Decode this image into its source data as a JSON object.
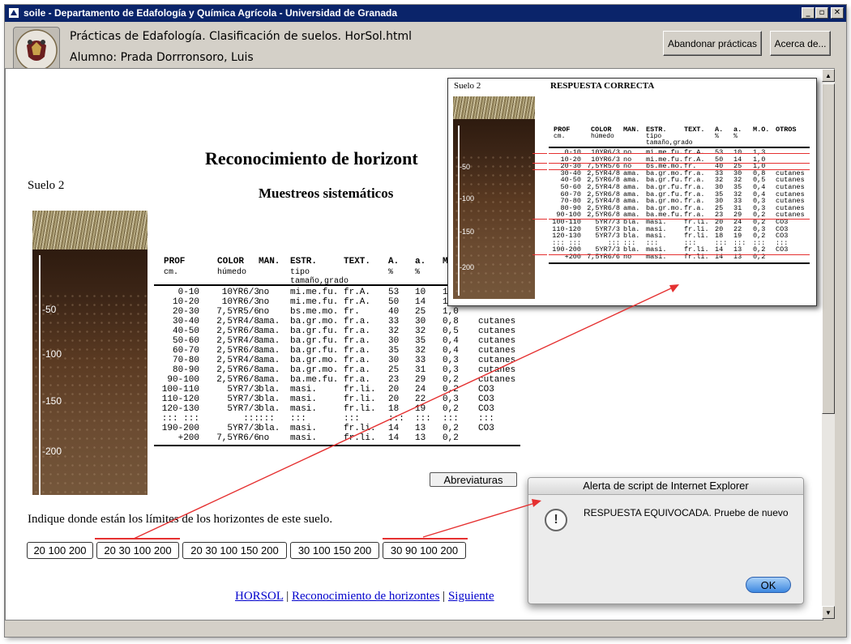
{
  "window": {
    "title": "soile - Departamento de Edafología y Química Agrícola - Universidad de Granada",
    "controls": {
      "minimize": "_",
      "maximize": "▫",
      "close": "✕"
    }
  },
  "header": {
    "practice_title": "Prácticas de Edafología. Clasificación de suelos. HorSol.html",
    "student": "Alumno: Prada Dorrronsoro, Luis",
    "abandon_button": "Abandonar prácticas",
    "about_button": "Acerca de..."
  },
  "page": {
    "title": "Reconocimiento de horizont",
    "subtitle": "Muestreos sistemáticos",
    "soil_label": "Suelo 2",
    "question": "Indique donde están los límites de los horizontes de este suelo.",
    "abbreviations_button": "Abreviaturas",
    "depth_marks": [
      "-50",
      "-100",
      "-150",
      "-200"
    ]
  },
  "table": {
    "headers": [
      "PROF",
      "COLOR",
      "MAN.",
      "ESTR.",
      "TEXT.",
      "A.",
      "a.",
      "M.O.",
      "OTROS"
    ],
    "subheaders": [
      "cm.",
      "húmedo",
      "",
      "tipo\ntamaño,grado",
      "",
      "%",
      "%",
      "",
      ""
    ],
    "main_visible_headers": [
      "PROF",
      "COLOR",
      "MAN.",
      "ESTR.",
      "TEXT.",
      "A.",
      "a."
    ],
    "rows": [
      [
        "0-10",
        "10YR6/3",
        "no",
        "mi.me.fu.",
        "fr.A.",
        "53",
        "10",
        "1,3",
        ""
      ],
      [
        "10-20",
        "10YR6/3",
        "no",
        "mi.me.fu.",
        "fr.A.",
        "50",
        "14",
        "1,0",
        ""
      ],
      [
        "20-30",
        "7,5YR5/6",
        "no",
        "bs.me.mo.",
        "fr.",
        "40",
        "25",
        "1,0",
        ""
      ],
      [
        "30-40",
        "2,5YR4/8",
        "ama.",
        "ba.gr.mo.",
        "fr.a.",
        "33",
        "30",
        "0,8",
        "cutanes"
      ],
      [
        "40-50",
        "2,5YR6/8",
        "ama.",
        "ba.gr.fu.",
        "fr.a.",
        "32",
        "32",
        "0,5",
        "cutanes"
      ],
      [
        "50-60",
        "2,5YR4/8",
        "ama.",
        "ba.gr.fu.",
        "fr.a.",
        "30",
        "35",
        "0,4",
        "cutanes"
      ],
      [
        "60-70",
        "2,5YR6/8",
        "ama.",
        "ba.gr.fu.",
        "fr.a.",
        "35",
        "32",
        "0,4",
        "cutanes"
      ],
      [
        "70-80",
        "2,5YR4/8",
        "ama.",
        "ba.gr.mo.",
        "fr.a.",
        "30",
        "33",
        "0,3",
        "cutanes"
      ],
      [
        "80-90",
        "2,5YR6/8",
        "ama.",
        "ba.gr.mo.",
        "fr.a.",
        "25",
        "31",
        "0,3",
        "cutanes"
      ],
      [
        "90-100",
        "2,5YR6/8",
        "ama.",
        "ba.me.fu.",
        "fr.a.",
        "23",
        "29",
        "0,2",
        "cutanes"
      ],
      [
        "100-110",
        "5YR7/3",
        "bla.",
        "masi.",
        "fr.li.",
        "20",
        "24",
        "0,2",
        "CO3"
      ],
      [
        "110-120",
        "5YR7/3",
        "bla.",
        "masi.",
        "fr.li.",
        "20",
        "22",
        "0,3",
        "CO3"
      ],
      [
        "120-130",
        "5YR7/3",
        "bla.",
        "masi.",
        "fr.li.",
        "18",
        "19",
        "0,2",
        "CO3"
      ],
      [
        "::: :::",
        ":::",
        ":::",
        ":::",
        ":::",
        ":::",
        ":::",
        ":::",
        ":::"
      ],
      [
        "190-200",
        "5YR7/3",
        "bla.",
        "masi.",
        "fr.li.",
        "14",
        "13",
        "0,2",
        "CO3"
      ],
      [
        "+200",
        "7,5YR6/6",
        "no",
        "masi.",
        "fr.li.",
        "14",
        "13",
        "0,2",
        ""
      ]
    ]
  },
  "answers": {
    "options": [
      "20 100 200",
      "20 30 100 200",
      "20 30 100 150 200",
      "30 100 150 200",
      "30 90 100 200"
    ]
  },
  "correct_answer_panel": {
    "soil_label": "Suelo 2",
    "title": "RESPUESTA CORRECTA"
  },
  "footer": {
    "links": [
      "HORSOL",
      "Reconocimiento de horizontes",
      "Siguiente"
    ],
    "separator": "|"
  },
  "dialog": {
    "title": "Alerta de script de Internet Explorer",
    "icon": "!",
    "message": "RESPUESTA EQUIVOCADA. Pruebe de nuevo",
    "ok": "OK"
  },
  "colors": {
    "titlebar": "#0a246a",
    "link": "#0000cc",
    "highlight_red": "#e53030"
  }
}
